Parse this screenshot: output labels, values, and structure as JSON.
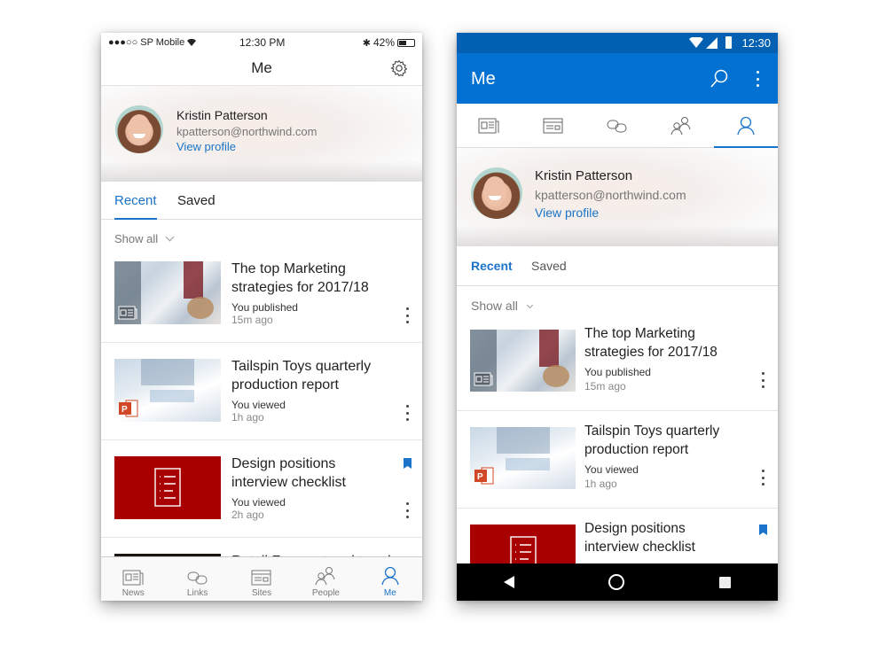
{
  "profile": {
    "name": "Kristin Patterson",
    "email": "kpatterson@northwind.com",
    "view_profile": "View profile"
  },
  "tabs": {
    "recent": "Recent",
    "saved": "Saved"
  },
  "show_all": "Show all",
  "items": [
    {
      "title_line1": "The top Marketing",
      "title_line2": "strategies for 2017/18",
      "action": "You published",
      "time": "15m ago",
      "type": "news",
      "bookmarked": false
    },
    {
      "title_line1": "Tailspin Toys quarterly",
      "title_line2": "production report",
      "action": "You viewed",
      "time": "1h ago",
      "type": "powerpoint",
      "bookmarked": false
    },
    {
      "title_line1": "Design positions",
      "title_line2": "interview checklist",
      "action": "You viewed",
      "time": "2h ago",
      "type": "checklist",
      "bookmarked": true
    },
    {
      "title_line1": "Retail Forecast and trend",
      "title_line2": "",
      "action": "",
      "time": "",
      "type": "photo",
      "bookmarked": false
    }
  ],
  "ios": {
    "status": {
      "carrier": "●●●○○ SP Mobile",
      "time": "12:30 PM",
      "battery": "42%"
    },
    "title": "Me",
    "tabbar": [
      {
        "label": "News",
        "icon": "news-icon"
      },
      {
        "label": "Links",
        "icon": "links-icon"
      },
      {
        "label": "Sites",
        "icon": "sites-icon"
      },
      {
        "label": "People",
        "icon": "people-icon"
      },
      {
        "label": "Me",
        "icon": "person-icon",
        "active": true
      }
    ]
  },
  "android": {
    "status": {
      "time": "12:30"
    },
    "title": "Me",
    "tabs": [
      "news-icon",
      "sites-icon",
      "links-icon",
      "people-icon",
      "person-icon"
    ],
    "active_tab": "person-icon"
  },
  "colors": {
    "accent": "#1b74c9",
    "appbar": "#0271d1",
    "statusbar": "#0160b2",
    "thumb_red": "#a80000"
  }
}
